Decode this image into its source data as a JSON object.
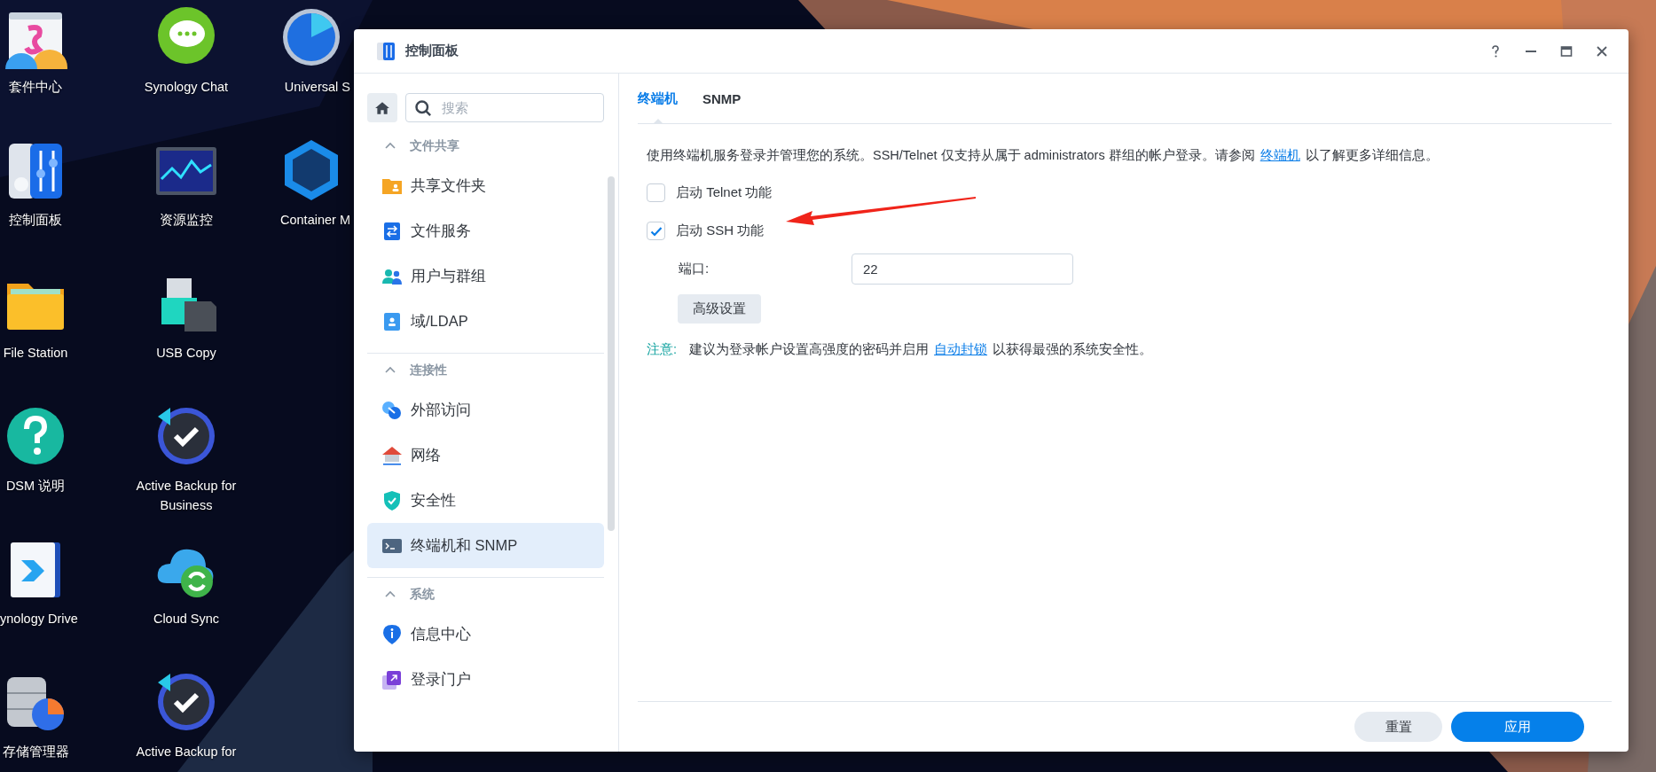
{
  "desktop": {
    "columns": [
      {
        "icons": [
          {
            "label": "套件中心"
          },
          {
            "label": "控制面板"
          },
          {
            "label": "File Station"
          },
          {
            "label": "DSM 说明"
          },
          {
            "label": "ynology Drive"
          },
          {
            "label": "存储管理器"
          }
        ]
      },
      {
        "icons": [
          {
            "label": "Synology Chat"
          },
          {
            "label": "资源监控"
          },
          {
            "label": "USB Copy"
          },
          {
            "label": "Active Backup for Business"
          },
          {
            "label": "Cloud Sync"
          },
          {
            "label": "Active Backup for"
          }
        ]
      },
      {
        "icons": [
          {
            "label": "Universal S"
          },
          {
            "label": "Container M"
          }
        ]
      }
    ]
  },
  "window": {
    "title": "控制面板"
  },
  "sidebar": {
    "search": {
      "placeholder": "搜索"
    },
    "sections": [
      {
        "title": "文件共享",
        "expanded": true,
        "items": [
          {
            "label": "共享文件夹",
            "selected": false
          },
          {
            "label": "文件服务",
            "selected": false
          },
          {
            "label": "用户与群组",
            "selected": false
          },
          {
            "label": "域/LDAP",
            "selected": false
          }
        ]
      },
      {
        "title": "连接性",
        "expanded": true,
        "items": [
          {
            "label": "外部访问",
            "selected": false
          },
          {
            "label": "网络",
            "selected": false
          },
          {
            "label": "安全性",
            "selected": false
          },
          {
            "label": "终端机和 SNMP",
            "selected": true
          }
        ]
      },
      {
        "title": "系统",
        "expanded": true,
        "items": [
          {
            "label": "信息中心",
            "selected": false
          },
          {
            "label": "登录门户",
            "selected": false
          }
        ]
      }
    ]
  },
  "tabs": [
    {
      "label": "终端机",
      "selected": true
    },
    {
      "label": "SNMP",
      "selected": false
    }
  ],
  "description": {
    "text_before": "使用终端机服务登录并管理您的系统。SSH/Telnet 仅支持从属于 administrators 群组的帐户登录。请参阅 ",
    "link": "终端机",
    "text_after": " 以了解更多详细信息。"
  },
  "options": [
    {
      "label": "启动 Telnet 功能",
      "checked": false
    },
    {
      "label": "启动 SSH 功能",
      "checked": true
    }
  ],
  "port": {
    "label": "端口:",
    "value": "22"
  },
  "advanced_button": "高级设置",
  "notice": {
    "label": "注意:",
    "text_before": "建议为登录帐户设置高强度的密码并启用 ",
    "link": "自动封锁",
    "text_after": " 以获得最强的系统安全性。"
  },
  "footer_buttons": [
    {
      "label": "重置",
      "kind": "secondary"
    },
    {
      "label": "应用",
      "kind": "primary"
    }
  ]
}
